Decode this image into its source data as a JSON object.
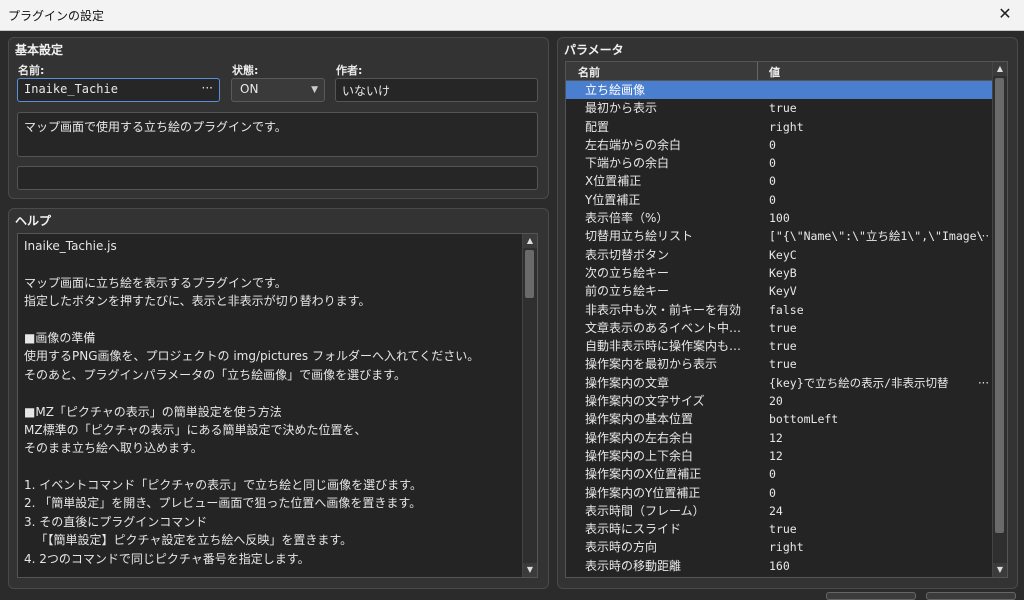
{
  "window": {
    "title": "プラグインの設定",
    "close_glyph": "✕"
  },
  "basic": {
    "title": "基本設定",
    "name_label": "名前:",
    "name_value": "Inaike_Tachie",
    "name_more": "···",
    "status_label": "状態:",
    "status_value": "ON",
    "author_label": "作者:",
    "author_value": "いないけ",
    "description": "マップ画面で使用する立ち絵のプラグインです。",
    "extra": ""
  },
  "help": {
    "title": "ヘルプ",
    "lines": [
      "Inaike_Tachie.js",
      "",
      "マップ画面に立ち絵を表示するプラグインです。",
      "指定したボタンを押すたびに、表示と非表示が切り替わります。",
      "",
      "■画像の準備",
      "使用するPNG画像を、プロジェクトの img/pictures フォルダーへ入れてください。",
      "そのあと、プラグインパラメータの「立ち絵画像」で画像を選びます。",
      "",
      "■MZ「ピクチャの表示」の簡単設定を使う方法",
      "MZ標準の「ピクチャの表示」にある簡単設定で決めた位置を、",
      "そのまま立ち絵へ取り込めます。",
      "",
      "1. イベントコマンド「ピクチャの表示」で立ち絵と同じ画像を選びます。",
      "2. 「簡単設定」を開き、プレビュー画面で狙った位置へ画像を置きます。",
      "3. その直後にプラグインコマンド",
      "   「【簡単設定】ピクチャ設定を立ち絵へ反映」を置きます。",
      "4. 2つのコマンドで同じピクチャ番号を指定します。"
    ]
  },
  "params": {
    "title": "パラメータ",
    "col_name": "名前",
    "col_value": "値",
    "rows": [
      {
        "k": "立ち絵画像",
        "v": ""
      },
      {
        "k": "最初から表示",
        "v": "true"
      },
      {
        "k": "配置",
        "v": "right"
      },
      {
        "k": "左右端からの余白",
        "v": "0"
      },
      {
        "k": "下端からの余白",
        "v": "0"
      },
      {
        "k": "X位置補正",
        "v": "0"
      },
      {
        "k": "Y位置補正",
        "v": "0"
      },
      {
        "k": "表示倍率（%）",
        "v": "100"
      },
      {
        "k": "切替用立ち絵リスト",
        "v": "[\"{\\\"Name\\\":\\\"立ち絵1\\\",\\\"Image\\",
        "more": "···"
      },
      {
        "k": "表示切替ボタン",
        "v": "KeyC"
      },
      {
        "k": "次の立ち絵キー",
        "v": "KeyB"
      },
      {
        "k": "前の立ち絵キー",
        "v": "KeyV"
      },
      {
        "k": "非表示中も次・前キーを有効",
        "v": "false"
      },
      {
        "k": "文章表示のあるイベント中…",
        "v": "true"
      },
      {
        "k": "自動非表示時に操作案内も…",
        "v": "true"
      },
      {
        "k": "操作案内を最初から表示",
        "v": "true"
      },
      {
        "k": "操作案内の文章",
        "v": "{key}で立ち絵の表示/非表示切替",
        "more": "···"
      },
      {
        "k": "操作案内の文字サイズ",
        "v": "20"
      },
      {
        "k": "操作案内の基本位置",
        "v": "bottomLeft"
      },
      {
        "k": "操作案内の左右余白",
        "v": "12"
      },
      {
        "k": "操作案内の上下余白",
        "v": "12"
      },
      {
        "k": "操作案内のX位置補正",
        "v": "0"
      },
      {
        "k": "操作案内のY位置補正",
        "v": "0"
      },
      {
        "k": "表示時間（フレーム）",
        "v": "24"
      },
      {
        "k": "表示時にスライド",
        "v": "true"
      },
      {
        "k": "表示時の方向",
        "v": "right"
      },
      {
        "k": "表示時の移動距離",
        "v": "160"
      }
    ]
  },
  "colors": {
    "selected_row": "#4a7fd0",
    "accent_border": "#5b8fd6"
  },
  "icons": {
    "scroll_up": "▲",
    "scroll_down": "▼",
    "dropdown": "▼"
  }
}
